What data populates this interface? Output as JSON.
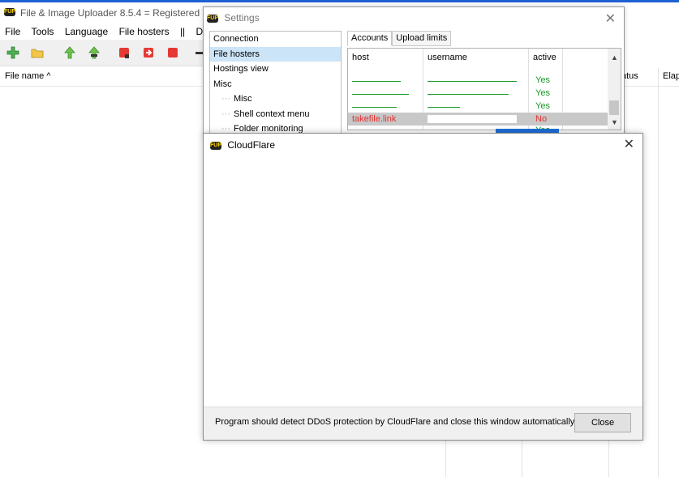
{
  "app": {
    "title": "File & Image Uploader 8.5.4  = Registered =",
    "icon_text": "FUP",
    "menu": [
      "File",
      "Tools",
      "Language",
      "File hosters",
      "||",
      "Deve"
    ]
  },
  "main": {
    "columns": {
      "file_name": "File name  ^",
      "status": "atus",
      "elapsed": "Elap"
    }
  },
  "settings": {
    "title": "Settings",
    "nav": [
      {
        "label": "Connection"
      },
      {
        "label": "File hosters"
      },
      {
        "label": "Hostings view"
      },
      {
        "label": "Misc"
      }
    ],
    "nav_children": [
      {
        "label": "Misc"
      },
      {
        "label": "Shell context menu"
      },
      {
        "label": "Folder monitoring"
      }
    ],
    "tabs": [
      "Accounts",
      "Upload limits"
    ],
    "grid_headers": [
      "host",
      "username",
      "active"
    ],
    "rows": [
      {
        "host": "",
        "username": "",
        "active": "Yes"
      },
      {
        "host": "",
        "username": "",
        "active": "Yes"
      },
      {
        "host": "",
        "username": "",
        "active": "Yes"
      },
      {
        "host": "takefile.link",
        "username": "",
        "active": "No"
      },
      {
        "host": "",
        "username": "",
        "active": "Yes"
      }
    ]
  },
  "cloudflare": {
    "title": "CloudFlare",
    "message": "Program should detect DDoS protection by CloudFlare and close this window automatically.",
    "close_label": "Close"
  }
}
